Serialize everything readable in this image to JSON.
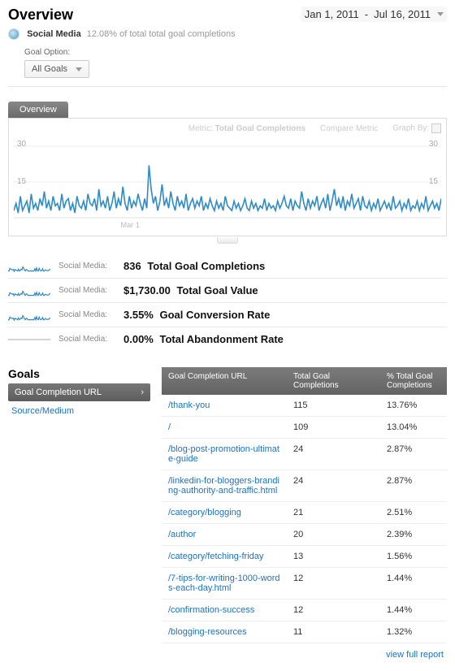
{
  "header": {
    "title": "Overview",
    "date_start": "Jan 1, 2011",
    "date_end": "Jul 16, 2011"
  },
  "segment": {
    "name": "Social Media",
    "note": "12.08% of total total goal completions"
  },
  "goal_option": {
    "label": "Goal Option:",
    "selected": "All Goals"
  },
  "overview_tab": "Overview",
  "chart_toolbar": {
    "metric_label": "Metric:",
    "metric_value": "Total Goal Completions",
    "compare_label": "Compare Metric",
    "graph_by_label": "Graph By:"
  },
  "chart_y": {
    "tick1": "30",
    "tick2": "15"
  },
  "chart_data": {
    "type": "line",
    "title": "Total Goal Completions",
    "xlabel": "",
    "ylabel": "",
    "ylim": [
      0,
      30
    ],
    "x_range": "Jan 1, 2011 – Jul 16, 2011 (daily)",
    "series": [
      {
        "name": "Social Media",
        "values": [
          3,
          6,
          2,
          9,
          3,
          5,
          7,
          2,
          10,
          4,
          6,
          3,
          8,
          5,
          11,
          4,
          7,
          3,
          9,
          5,
          6,
          3,
          10,
          4,
          7,
          8,
          3,
          6,
          2,
          9,
          5,
          4,
          7,
          3,
          10,
          6,
          5,
          8,
          3,
          12,
          5,
          7,
          4,
          9,
          3,
          6,
          11,
          4,
          8,
          5,
          13,
          6,
          3,
          9,
          4,
          7,
          5,
          10,
          6,
          3,
          8,
          4,
          22,
          12,
          6,
          9,
          3,
          7,
          14,
          5,
          8,
          4,
          11,
          6,
          3,
          9,
          5,
          7,
          4,
          10,
          3,
          6,
          8,
          4,
          7,
          5,
          9,
          3,
          6,
          4,
          8,
          5,
          3,
          7,
          4,
          6,
          3,
          9,
          5,
          4,
          3,
          7,
          4,
          6,
          3,
          5,
          8,
          4,
          3,
          7,
          4,
          6,
          3,
          5,
          4,
          8,
          3,
          6,
          4,
          5,
          3,
          7,
          4,
          6,
          9,
          5,
          4,
          8,
          3,
          7,
          5,
          4,
          11,
          6,
          3,
          8,
          4,
          7,
          5,
          9,
          3,
          6,
          8,
          4,
          10,
          3,
          7,
          12,
          5,
          8,
          4,
          9,
          3,
          7,
          5,
          10,
          4,
          6,
          8,
          3,
          9,
          5,
          4,
          7,
          3,
          6,
          4,
          8,
          3,
          5,
          7,
          4,
          6,
          3,
          9,
          4,
          5,
          7,
          3,
          6,
          4,
          8,
          3,
          5,
          4,
          7,
          3,
          6,
          4,
          9,
          3,
          5,
          7,
          4,
          6,
          3,
          8
        ]
      }
    ]
  },
  "metrics": [
    {
      "segment": "Social Media:",
      "value": "836",
      "label": "Total Goal Completions",
      "spark": true
    },
    {
      "segment": "Social Media:",
      "value": "$1,730.00",
      "label": "Total Goal Value",
      "spark": true
    },
    {
      "segment": "Social Media:",
      "value": "3.55%",
      "label": "Goal Conversion Rate",
      "spark": true
    },
    {
      "segment": "Social Media:",
      "value": "0.00%",
      "label": "Total Abandonment Rate",
      "spark": false
    }
  ],
  "goals": {
    "title": "Goals",
    "side_active": "Goal Completion URL",
    "side_link": "Source/Medium",
    "columns": {
      "url": "Goal Completion URL",
      "total": "Total Goal Completions",
      "pct": "% Total Goal Completions"
    },
    "rows": [
      {
        "url": "/thank-you",
        "total": "115",
        "pct": "13.76%"
      },
      {
        "url": "/",
        "total": "109",
        "pct": "13.04%"
      },
      {
        "url": "/blog-post-promotion-ultimate-guide",
        "total": "24",
        "pct": "2.87%"
      },
      {
        "url": "/linkedin-for-bloggers-branding-authority-and-traffic.html",
        "total": "24",
        "pct": "2.87%"
      },
      {
        "url": "/category/blogging",
        "total": "21",
        "pct": "2.51%"
      },
      {
        "url": "/author",
        "total": "20",
        "pct": "2.39%"
      },
      {
        "url": "/category/fetching-friday",
        "total": "13",
        "pct": "1.56%"
      },
      {
        "url": "/7-tips-for-writing-1000-words-each-day.html",
        "total": "12",
        "pct": "1.44%"
      },
      {
        "url": "/confirmation-success",
        "total": "12",
        "pct": "1.44%"
      },
      {
        "url": "/blogging-resources",
        "total": "11",
        "pct": "1.32%"
      }
    ],
    "view_full": "view full report"
  }
}
